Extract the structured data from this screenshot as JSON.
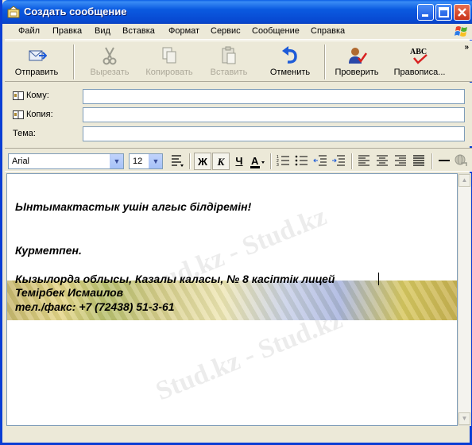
{
  "window": {
    "title": "Создать сообщение"
  },
  "menu": [
    "Файл",
    "Правка",
    "Вид",
    "Вставка",
    "Формат",
    "Сервис",
    "Сообщение",
    "Справка"
  ],
  "toolbar": {
    "send": "Отправить",
    "cut": "Вырезать",
    "copy": "Копировать",
    "paste": "Вставить",
    "undo": "Отменить",
    "check": "Проверить",
    "spelling": "Правописа..."
  },
  "headers": {
    "to_label": "Кому:",
    "cc_label": "Копия:",
    "subject_label": "Тема:",
    "to_value": "",
    "cc_value": "",
    "subject_value": ""
  },
  "format": {
    "font": "Arial",
    "size": "12",
    "bold": "Ж",
    "italic": "К",
    "underline": "Ч"
  },
  "message": {
    "line1": "Ынтымактастык ушін алгыс білдіремін!",
    "line2": "Курметпен.",
    "line3": "Кызылорда облысы, Казалы каласы, № 8 касіптік лицей",
    "line4": "Темірбек Исмаилов",
    "line5": "тел./факс: +7 (72438) 51-3-61"
  },
  "watermark_text": "Stud.kz - Stud.kz",
  "colors": {
    "title_bar": "#0a5ae0",
    "window_bg": "#ece9d8",
    "undo_icon": "#1d5bd8"
  }
}
